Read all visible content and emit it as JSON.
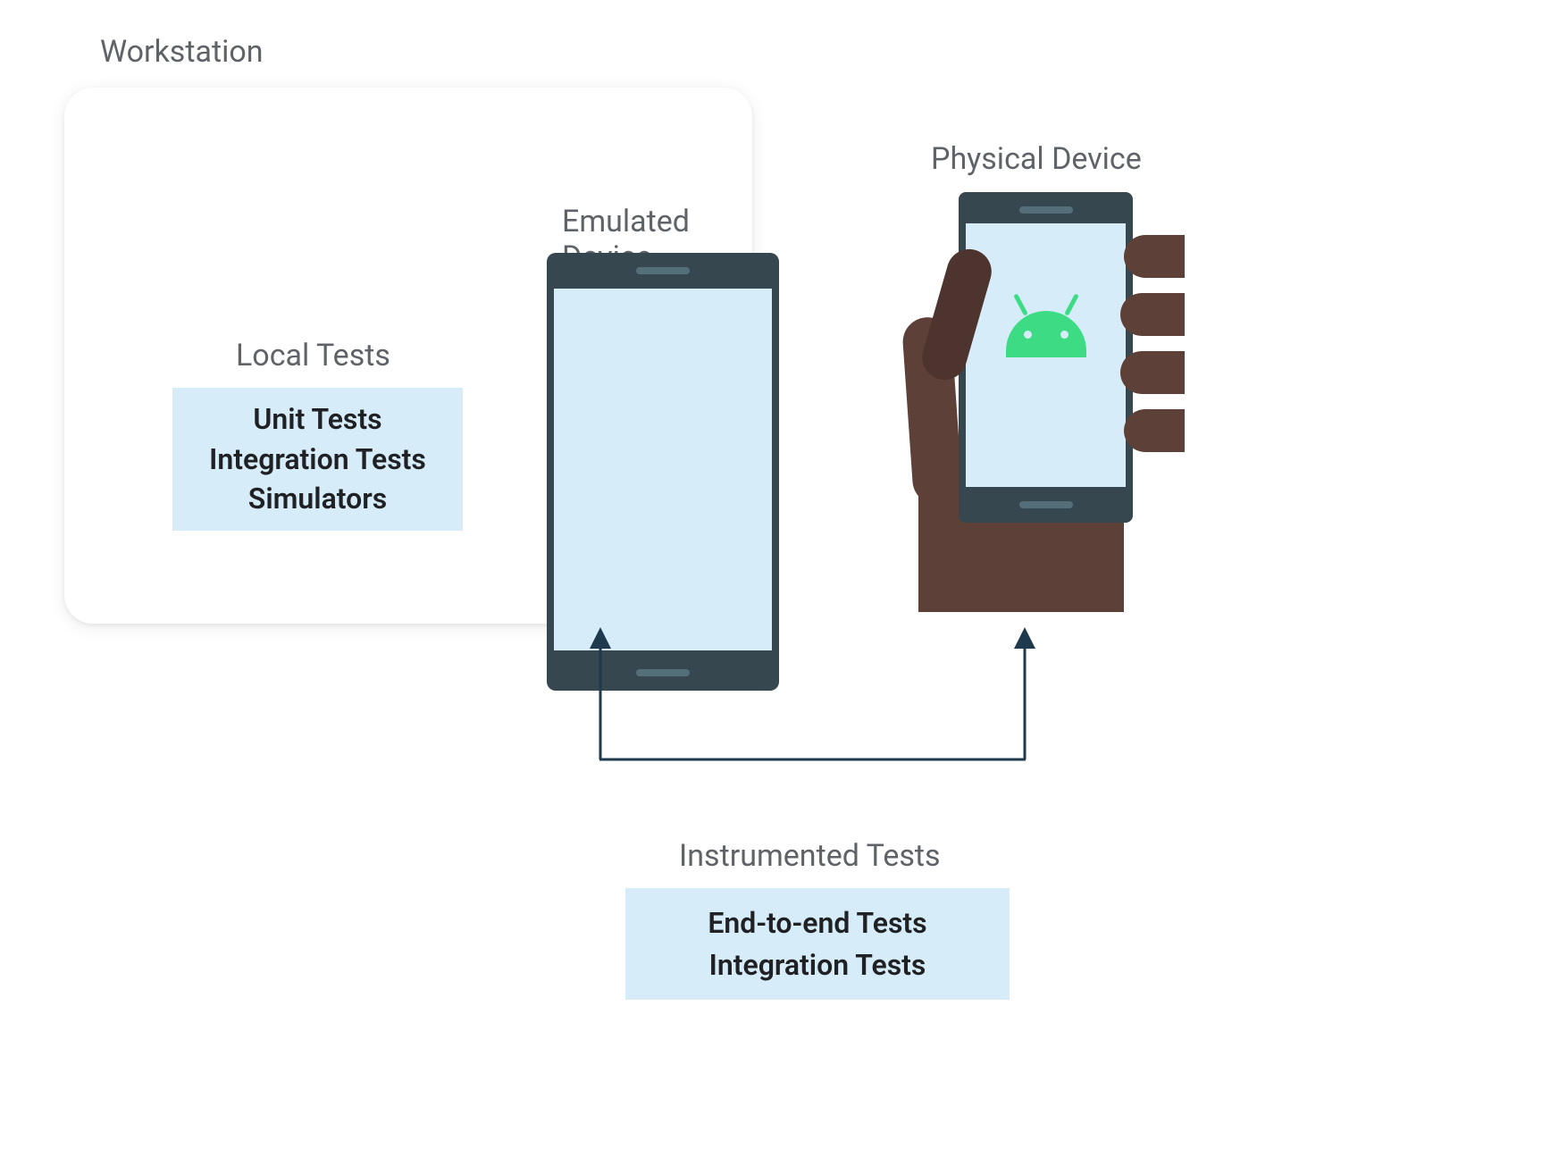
{
  "workstation": {
    "label": "Workstation",
    "local_tests": {
      "label": "Local Tests",
      "items": [
        "Unit Tests",
        "Integration Tests",
        "Simulators"
      ]
    },
    "emulated_device_label": "Emulated Device"
  },
  "physical_device": {
    "label": "Physical Device"
  },
  "instrumented": {
    "label": "Instrumented Tests",
    "items": [
      "End-to-end Tests",
      "Integration Tests"
    ]
  },
  "colors": {
    "panel_bg": "#d6ecf8",
    "text_muted": "#5f6368",
    "text_strong": "#202124",
    "device_frame": "#37474f",
    "hand": "#5d4037",
    "hand_dark": "#4e342e",
    "android_green": "#3ddc84",
    "connector": "#1f3a4d"
  }
}
